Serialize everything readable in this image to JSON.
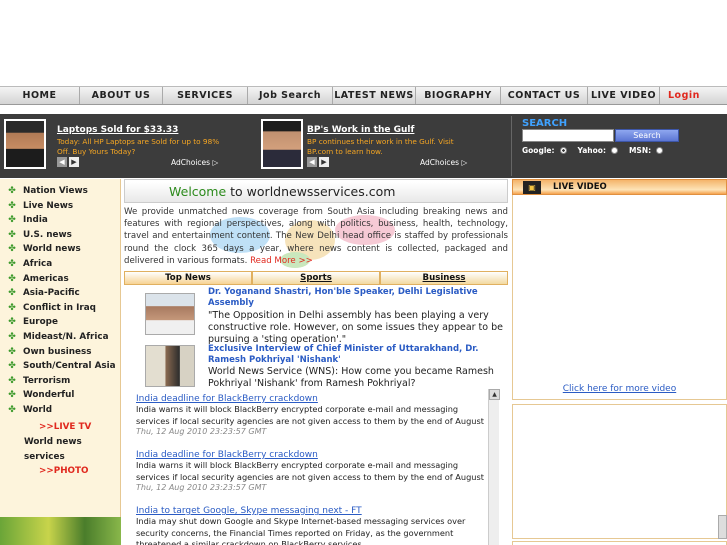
{
  "nav": {
    "items": [
      "HOME",
      "ABOUT US",
      "SERVICES",
      "Job Search",
      "LATEST NEWS",
      "BIOGRAPHY",
      "CONTACT US",
      "LIVE VIDEO"
    ],
    "login": "Login"
  },
  "ads": [
    {
      "title": "Laptops Sold for $33.33",
      "text_line1": "Today: All HP Laptops are Sold for up to 98%",
      "text_line2": "Off. Buy Yours Today?",
      "adchoices": "AdChoices ▷"
    },
    {
      "title": "BP's Work in the Gulf",
      "text_line1": "BP continues their work in the Gulf. Visit",
      "text_line2": "BP.com to learn how.",
      "adchoices": "AdChoices ▷"
    }
  ],
  "search": {
    "title": "SEARCH",
    "button": "Search",
    "engines": [
      "Google:",
      "Yahoo:",
      "MSN:"
    ]
  },
  "sidebar": {
    "items": [
      "Nation Views",
      "Live News",
      "India",
      "U.S. news",
      "World news",
      "Africa",
      "Americas",
      "Asia-Pacific",
      "Conflict in Iraq",
      "Europe",
      "Mideast/N. Africa",
      "Own business",
      "South/Central Asia",
      "Terrorism",
      "Wonderful",
      "World"
    ],
    "sub1": ">>LIVE TV",
    "plain1": "World news",
    "plain2": "services",
    "sub2": ">>PHOTO"
  },
  "welcome": {
    "word": "Welcome",
    "rest": " to worldnewsservices.com"
  },
  "intro": {
    "text": "We provide unmatched news coverage from South Asia including breaking news and features with regional perspectives, along with politics, business, health, technology, travel and entertainment content. The New Delhi head office is staffed by professionals round the clock 365 days a year, where news content is collected, packaged and delivered in various formats. ",
    "read_more": "Read More >>"
  },
  "tabs": [
    "Top News",
    "Sports",
    "Business"
  ],
  "stories": [
    {
      "title": "Dr. Yoganand Shastri, Hon'ble Speaker, Delhi Legislative Assembly",
      "text": "\"The Opposition in Delhi assembly has been playing a very constructive role. However, on some issues they appear to be pursuing a 'sting operation'.\""
    },
    {
      "title": "Exclusive Interview of Chief Minister of Uttarakhand, Dr. Ramesh Pokhriyal 'Nishank'",
      "text": "World News Service (WNS): How come you became Ramesh Pokhriyal 'Nishank' from Ramesh Pokhriyal?"
    }
  ],
  "news": [
    {
      "title": "India deadline for BlackBerry crackdown",
      "desc": "India warns it will block BlackBerry encrypted corporate e-mail and messaging services if local security agencies are not given access to them by the end of August",
      "date": "Thu, 12 Aug 2010 23:23:57 GMT"
    },
    {
      "title": "India deadline for BlackBerry crackdown",
      "desc": "India warns it will block BlackBerry encrypted corporate e-mail and messaging services if local security agencies are not given access to them by the end of August",
      "date": "Thu, 12 Aug 2010 23:23:57 GMT"
    },
    {
      "title": "India to target Google, Skype messaging next - FT",
      "desc": "India may shut down Google and Skype Internet-based messaging services over security concerns, the Financial Times reported on Friday, as the government threatened a similar crackdown on BlackBerry services.",
      "date": ""
    }
  ],
  "video": {
    "label": "LIVE VIDEO",
    "more": "Click here for more video"
  },
  "colors": {
    "accent_red": "#e0281e",
    "link_blue": "#2a5bc4",
    "banner_bg": "#3c3c3c",
    "ad_text_orange": "#f5a623",
    "bullet_green": "#3d9a2c"
  }
}
